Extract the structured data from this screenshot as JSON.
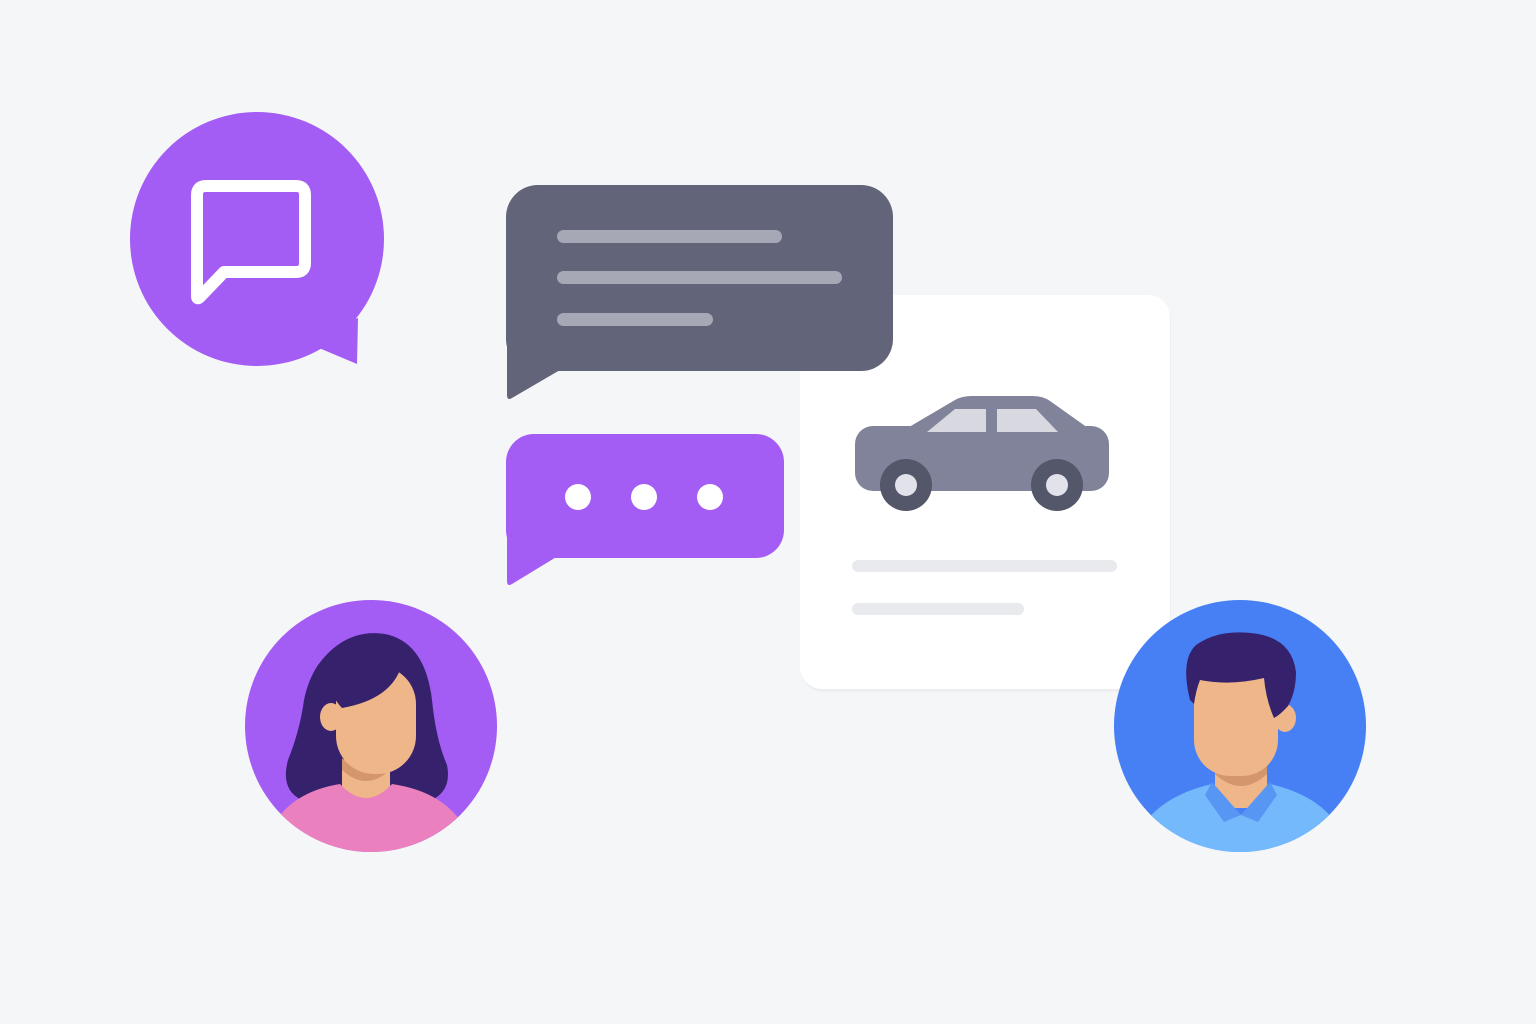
{
  "colors": {
    "background": "#f5f6f8",
    "brand_purple": "#a35cf4",
    "message_dark": "#62657a",
    "message_line": "#a6a8b6",
    "card_white": "#ffffff",
    "card_line": "#e8eaee",
    "car_body": "#80839a",
    "car_window": "#d8d9e0",
    "car_wheel": "#54566a",
    "car_hub": "#e2e3ea",
    "hair_dark": "#36216d",
    "skin": "#efb68a",
    "skin_shadow": "#d4976d",
    "woman_shirt": "#ea80be",
    "man_circle": "#4680f4",
    "man_shirt": "#73b9fc",
    "man_collar": "#5796f2"
  },
  "icons": {
    "app_badge": "chat-bubble-icon",
    "typing_indicator": "ellipsis-icon",
    "vehicle": "car-icon",
    "buyer": "woman-avatar",
    "seller": "man-avatar"
  },
  "typing_dots": 3,
  "message_lines": 3,
  "listing_card_lines": 2
}
